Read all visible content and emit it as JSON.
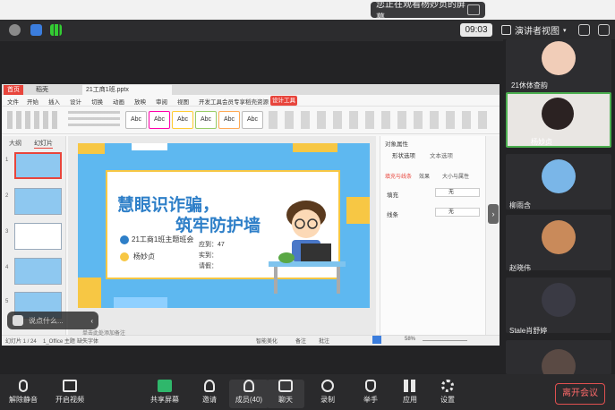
{
  "banner": {
    "text": "您正在观看杨妙贞的屏幕"
  },
  "meeting": {
    "timer": "09:03",
    "view_label": "演讲者视图"
  },
  "wps": {
    "tabs": [
      "首页",
      "稻壳",
      "21工商1班.pptx"
    ],
    "ribbon_tabs": [
      "文件",
      "开始",
      "插入",
      "设计",
      "切换",
      "动画",
      "放映",
      "审阅",
      "视图",
      "开发工具",
      "会员专享",
      "稻壳资源"
    ],
    "design_tab": "设计工具",
    "style_buttons": [
      "Abc",
      "Abc",
      "Abc",
      "Abc",
      "Abc",
      "Abc"
    ],
    "panel_tabs": [
      "大纲",
      "幻灯片"
    ],
    "props_title": "对象属性",
    "props_tabs": [
      "形状选项",
      "文本选项"
    ],
    "props_subtabs": [
      "填充与线条",
      "效果",
      "大小与属性"
    ],
    "props_fill_label": "填充",
    "props_fill_value": "无",
    "props_line_label": "线条",
    "props_line_value": "无",
    "status_left": "幻灯片 1 / 24",
    "status_theme": "1_Office 主题",
    "status_font": "缺失字体",
    "status_note": "单击此处添加备注",
    "status_zoom": "58%",
    "status_smart": "智能美化",
    "status_notes": "备注",
    "status_comment": "批注"
  },
  "slide": {
    "title_line1": "慧眼识诈骗，",
    "title_line2": "筑牢防护墙",
    "class_label": "21工商1班主题班会",
    "author": "杨妙贞",
    "stat_should": "应到：47",
    "stat_actual": "实到：",
    "stat_leave": "请假："
  },
  "chat": {
    "placeholder": "说点什么..."
  },
  "participants": [
    {
      "name": "21休体查韵"
    },
    {
      "name": "杨妙贞"
    },
    {
      "name": "柳雨含"
    },
    {
      "name": "赵晓伟"
    },
    {
      "name": "Stale肖舒婷"
    },
    {
      "name": ""
    }
  ],
  "toolbar": {
    "mute": "解除静音",
    "video": "开启视频",
    "share": "共享屏幕",
    "invite": "邀请",
    "members": "成员(40)",
    "chat": "聊天",
    "record": "录制",
    "raise": "举手",
    "apps": "应用",
    "settings": "设置",
    "leave": "离开会议"
  },
  "colors": {
    "accent": "#e8453c",
    "slide_blue": "#5eb8f0",
    "title_blue": "#2e7fc8",
    "active_border": "#4caf50"
  }
}
